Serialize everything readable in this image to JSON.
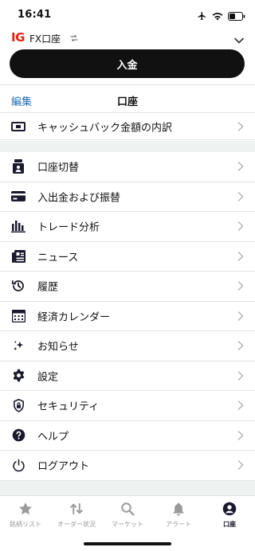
{
  "status": {
    "time": "16:41"
  },
  "account": {
    "logo": "IG",
    "name": "FX口座"
  },
  "deposit_label": "入金",
  "nav": {
    "edit": "編集",
    "title": "口座"
  },
  "top_item": {
    "label": "キャッシュバック金額の内訳",
    "icon": "cashback-icon"
  },
  "menu": [
    {
      "label": "口座切替",
      "icon": "account-switch-icon"
    },
    {
      "label": "入出金および振替",
      "icon": "card-icon"
    },
    {
      "label": "トレード分析",
      "icon": "bar-chart-icon"
    },
    {
      "label": "ニュース",
      "icon": "news-icon"
    },
    {
      "label": "履歴",
      "icon": "history-icon"
    },
    {
      "label": "経済カレンダー",
      "icon": "calendar-icon"
    },
    {
      "label": "お知らせ",
      "icon": "sparkle-icon"
    },
    {
      "label": "設定",
      "icon": "gear-icon"
    },
    {
      "label": "セキュリティ",
      "icon": "shield-icon"
    },
    {
      "label": "ヘルプ",
      "icon": "help-icon"
    },
    {
      "label": "ログアウト",
      "icon": "power-icon"
    }
  ],
  "tabs": [
    {
      "label": "銘柄リスト",
      "icon": "star-icon",
      "active": false
    },
    {
      "label": "オーダー状況",
      "icon": "transfer-icon",
      "active": false
    },
    {
      "label": "マーケット",
      "icon": "search-icon",
      "active": false
    },
    {
      "label": "アラート",
      "icon": "bell-icon",
      "active": false
    },
    {
      "label": "口座",
      "icon": "user-icon",
      "active": true
    }
  ],
  "colors": {
    "brand": "#e2231a",
    "link": "#1f6fb5",
    "band": "#eef3f2",
    "icon": "#1a1a2e"
  }
}
